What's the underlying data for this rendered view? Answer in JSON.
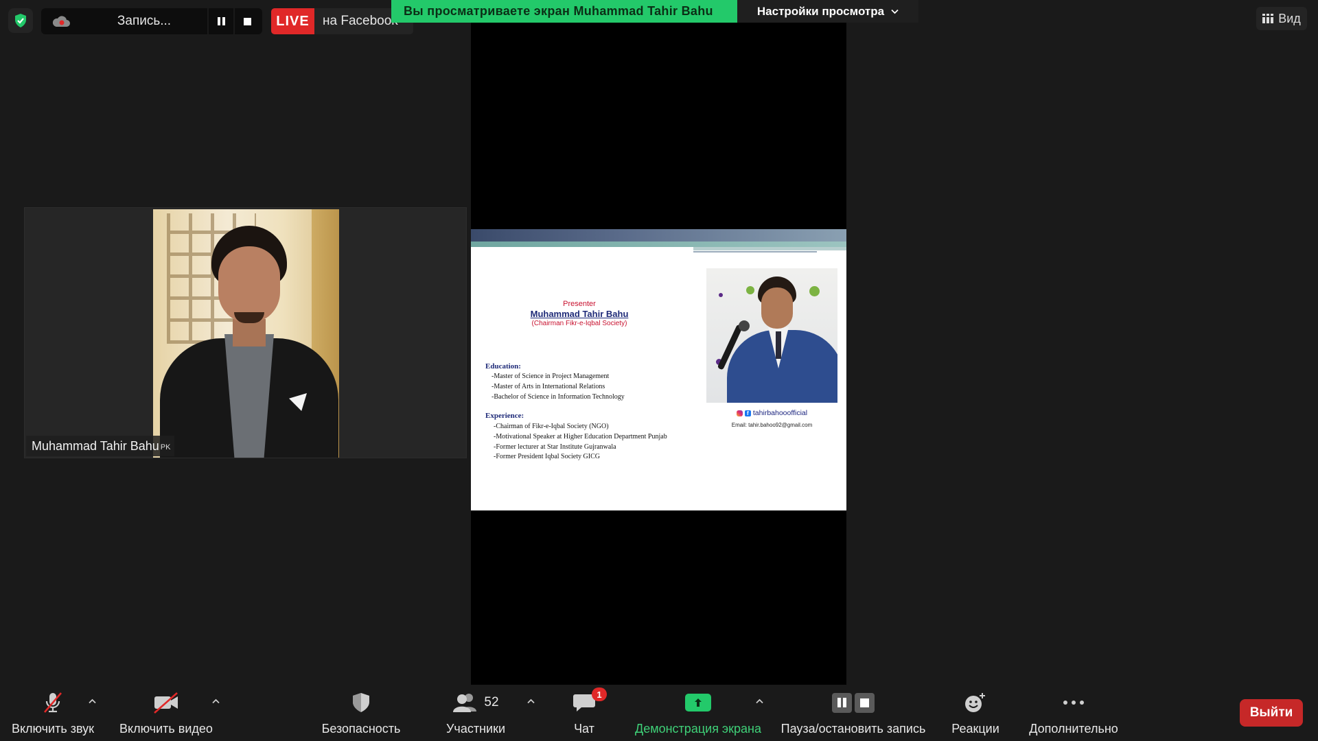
{
  "top_bar": {
    "recording_label": "Запись...",
    "live_badge": "LIVE",
    "live_destination": "на Facebook",
    "viewing_banner": "Вы просматриваете экран Muhammad Tahir Bahu",
    "view_settings_label": "Настройки просмотра",
    "view_button_label": "Вид"
  },
  "participant_tile": {
    "name": "Muhammad Tahir Bahu",
    "country_code": "PK"
  },
  "slide": {
    "presenter_label": "Presenter",
    "presenter_name": "Muhammad Tahir Bahu",
    "presenter_role": "(Chairman Fikr-e-Iqbal Society)",
    "education_heading": "Education:",
    "education_items": [
      "-Master of Science in Project Management",
      "-Master of Arts in International Relations",
      "-Bachelor of Science in Information Technology"
    ],
    "experience_heading": "Experience:",
    "experience_items": [
      "-Chairman of Fikr-e-Iqbal Society (NGO)",
      "-Motivational Speaker at Higher Education Department Punjab",
      "-Former lecturer at Star Institute Gujranwala",
      "-Former President Iqbal Society GICG"
    ],
    "social_handle": "tahirbahooofficial",
    "email": "Email: tahir.bahoo92@gmail.com"
  },
  "toolbar": {
    "unmute_label": "Включить звук",
    "start_video_label": "Включить видео",
    "security_label": "Безопасность",
    "participants_label": "Участники",
    "participants_count": "52",
    "chat_label": "Чат",
    "chat_badge": "1",
    "share_screen_label": "Демонстрация экрана",
    "pause_stop_recording_label": "Пауза/остановить запись",
    "reactions_label": "Реакции",
    "more_label": "Дополнительно",
    "leave_label": "Выйти"
  },
  "colors": {
    "background": "#1a1a1a",
    "live_red": "#e02828",
    "share_green": "#23c96a",
    "leave_red": "#c62828",
    "badge_red": "#e02828"
  },
  "icons": {
    "security_shield": "shield-check-icon",
    "recording": "cloud-record-icon",
    "pause": "pause-icon",
    "stop": "stop-icon",
    "view": "grid-view-icon",
    "mic": "mic-muted-icon",
    "video": "video-off-icon",
    "security": "shield-icon",
    "participants": "participants-icon",
    "chat": "chat-icon",
    "share": "share-screen-icon",
    "reactions": "reaction-icon",
    "more": "more-dots-icon"
  }
}
